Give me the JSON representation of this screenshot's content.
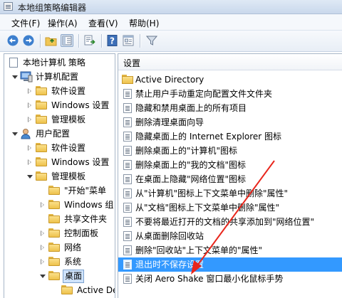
{
  "window": {
    "title": "本地组策略编辑器"
  },
  "menu": [
    "文件(F)",
    "操作(A)",
    "查看(V)",
    "帮助(H)"
  ],
  "toolbar": [
    "back-arrow-icon",
    "forward-arrow-icon",
    "up-folder-icon",
    "show-hide-tree-icon",
    "export-list-icon",
    "help-icon",
    "properties-icon",
    "filter-icon"
  ],
  "tree": {
    "items": [
      {
        "label": "本地计算机 策略",
        "level": 0,
        "expander": "none",
        "icon": "policy-doc-icon"
      },
      {
        "label": "计算机配置",
        "level": 1,
        "expander": "open",
        "icon": "computer-icon"
      },
      {
        "label": "软件设置",
        "level": 2,
        "expander": "closed",
        "icon": "folder-icon"
      },
      {
        "label": "Windows 设置",
        "level": 2,
        "expander": "closed",
        "icon": "folder-icon"
      },
      {
        "label": "管理模板",
        "level": 2,
        "expander": "closed",
        "icon": "folder-icon"
      },
      {
        "label": "用户配置",
        "level": 1,
        "expander": "open",
        "icon": "user-icon"
      },
      {
        "label": "软件设置",
        "level": 2,
        "expander": "closed",
        "icon": "folder-icon"
      },
      {
        "label": "Windows 设置",
        "level": 2,
        "expander": "closed",
        "icon": "folder-icon"
      },
      {
        "label": "管理模板",
        "level": 2,
        "expander": "open",
        "icon": "folder-icon"
      },
      {
        "label": "\"开始\"菜单",
        "level": 3,
        "expander": "none",
        "icon": "folder-icon"
      },
      {
        "label": "Windows 组",
        "level": 3,
        "expander": "closed",
        "icon": "folder-icon"
      },
      {
        "label": "共享文件夹",
        "level": 3,
        "expander": "none",
        "icon": "folder-icon"
      },
      {
        "label": "控制面板",
        "level": 3,
        "expander": "closed",
        "icon": "folder-icon"
      },
      {
        "label": "网络",
        "level": 3,
        "expander": "closed",
        "icon": "folder-icon"
      },
      {
        "label": "系统",
        "level": 3,
        "expander": "closed",
        "icon": "folder-icon"
      },
      {
        "label": "桌面",
        "level": 3,
        "expander": "open",
        "icon": "folder-icon",
        "selected": true
      },
      {
        "label": "Active De",
        "level": 4,
        "expander": "none",
        "icon": "folder-icon"
      }
    ]
  },
  "list": {
    "header": "设置",
    "items": [
      {
        "label": "Active Directory",
        "type": "folder"
      },
      {
        "label": "禁止用户手动重定向配置文件文件夹",
        "type": "setting"
      },
      {
        "label": "隐藏和禁用桌面上的所有项目",
        "type": "setting"
      },
      {
        "label": "删除清理桌面向导",
        "type": "setting"
      },
      {
        "label": "隐藏桌面上的 Internet Explorer 图标",
        "type": "setting"
      },
      {
        "label": "删除桌面上的\"计算机\"图标",
        "type": "setting"
      },
      {
        "label": "删除桌面上的\"我的文档\"图标",
        "type": "setting"
      },
      {
        "label": "在桌面上隐藏\"网络位置\"图标",
        "type": "setting"
      },
      {
        "label": "从\"计算机\"图标上下文菜单中删除\"属性\"",
        "type": "setting"
      },
      {
        "label": "从\"文档\"图标上下文菜单中删除\"属性\"",
        "type": "setting"
      },
      {
        "label": "不要将最近打开的文档的共享添加到\"网络位置\"",
        "type": "setting"
      },
      {
        "label": "从桌面删除回收站",
        "type": "setting"
      },
      {
        "label": "删除\"回收站\"上下文菜单的\"属性\"",
        "type": "setting"
      },
      {
        "label": "退出时不保存设置",
        "type": "setting",
        "selected": true
      },
      {
        "label": "关闭 Aero Shake 窗口最小化鼠标手势",
        "type": "setting"
      }
    ]
  },
  "colors": {
    "selection": "#3399ff",
    "annotation_arrow": "#e8261c"
  }
}
